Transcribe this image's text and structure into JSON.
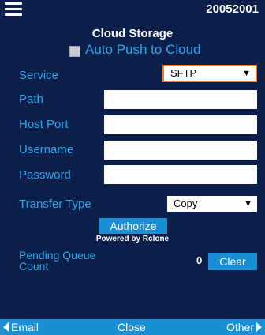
{
  "header": {
    "build_number": "20052001",
    "menu_icon": "hamburger-icon"
  },
  "title": "Cloud Storage",
  "auto_push": {
    "label": "Auto Push to Cloud",
    "checked": false
  },
  "form": {
    "service": {
      "label": "Service",
      "value": "SFTP"
    },
    "path": {
      "label": "Path",
      "value": ""
    },
    "host_port": {
      "label": "Host Port",
      "value": ""
    },
    "username": {
      "label": "Username",
      "value": ""
    },
    "password": {
      "label": "Password",
      "value": ""
    },
    "transfer_type": {
      "label": "Transfer Type",
      "value": "Copy"
    }
  },
  "authorize_label": "Authorize",
  "powered_by": "Powered by Rclone",
  "pending": {
    "label_line1": "Pending Queue",
    "label_line2": "Count",
    "count": "0",
    "clear_label": "Clear"
  },
  "bottom_bar": {
    "email_label": "Email",
    "close_label": "Close",
    "other_label": "Other"
  },
  "colors": {
    "background": "#0b1f4a",
    "label_blue": "#27a6e8",
    "button_blue": "#1a8fd6",
    "focus_orange": "#f07d1e"
  }
}
